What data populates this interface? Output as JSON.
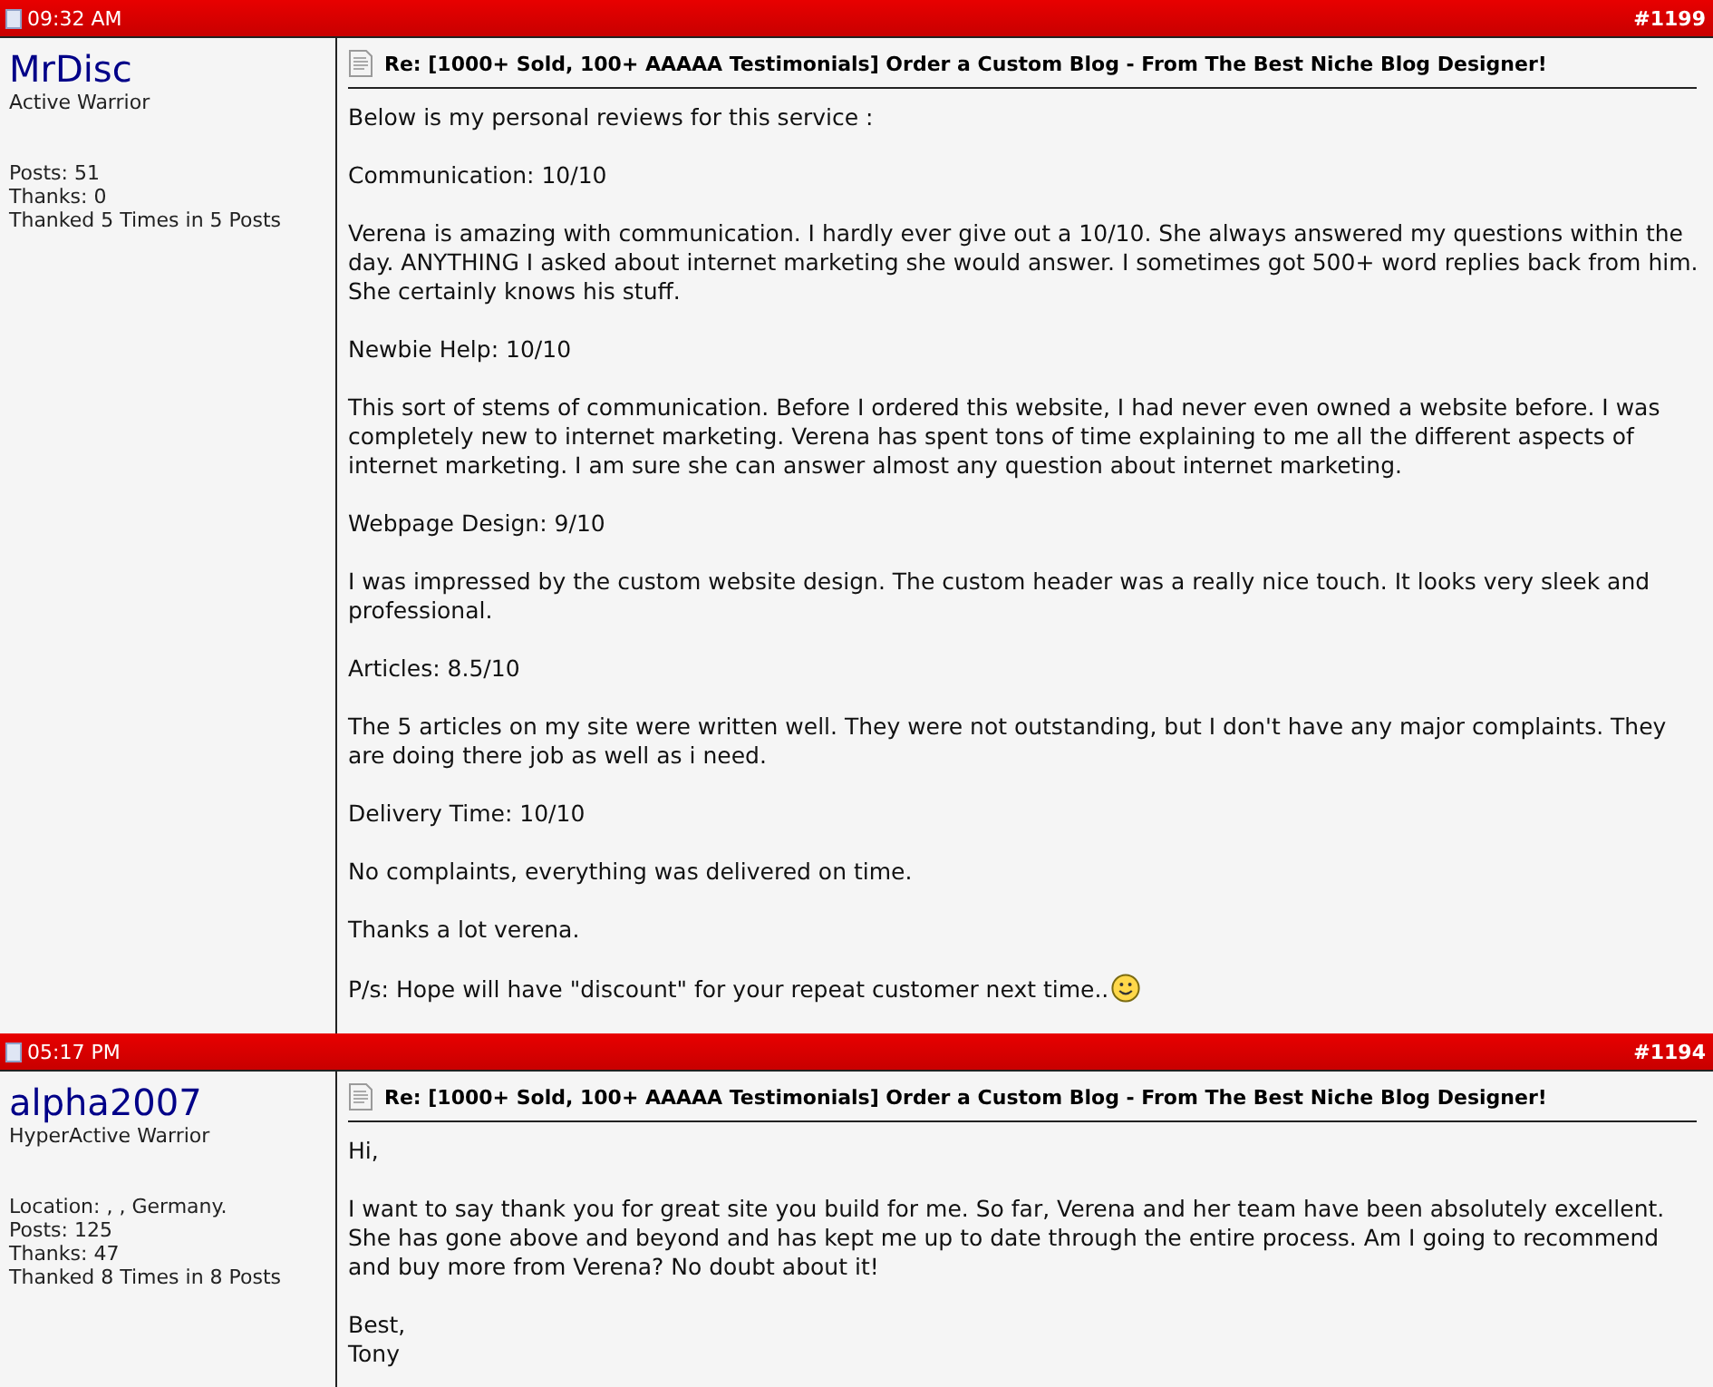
{
  "posts": [
    {
      "time": "09:32 AM",
      "number": "#1199",
      "user": {
        "name": "MrDisc",
        "rank": "Active Warrior",
        "stats": [
          "Posts: 51",
          "Thanks: 0",
          "Thanked 5 Times in 5 Posts"
        ]
      },
      "title": "Re: [1000+ Sold, 100+ AAAAA Testimonials] Order a Custom Blog - From The Best Niche Blog Designer!",
      "paragraphs": [
        {
          "text": "Below is my personal reviews for this service :",
          "smiley": false
        },
        {
          "text": "Communication: 10/10",
          "smiley": false
        },
        {
          "text": "Verena is amazing with communication. I hardly ever give out a 10/10. She always answered my questions within the day. ANYTHING I asked about internet marketing she would answer. I sometimes got 500+ word replies back from him. She certainly knows his stuff.",
          "smiley": false
        },
        {
          "text": "Newbie Help: 10/10",
          "smiley": false
        },
        {
          "text": "This sort of stems of communication. Before I ordered this website, I had never even owned a website before. I was completely new to internet marketing. Verena has spent tons of time explaining to me all the different aspects of internet marketing. I am sure she can answer almost any question about internet marketing.",
          "smiley": false
        },
        {
          "text": "Webpage Design: 9/10",
          "smiley": false
        },
        {
          "text": "I was impressed by the custom website design. The custom header was a really nice touch. It looks very sleek and professional.",
          "smiley": false
        },
        {
          "text": "Articles: 8.5/10",
          "smiley": false
        },
        {
          "text": "The 5 articles on my site were written well. They were not outstanding, but I don't have any major complaints. They are doing there job as well as i need.",
          "smiley": false
        },
        {
          "text": "Delivery Time: 10/10",
          "smiley": false
        },
        {
          "text": "No complaints, everything was delivered on time.",
          "smiley": false
        },
        {
          "text": "Thanks a lot verena.",
          "smiley": false
        },
        {
          "text": "P/s: Hope will have \"discount\" for your repeat customer next time..",
          "smiley": true
        }
      ]
    },
    {
      "time": "05:17 PM",
      "number": "#1194",
      "user": {
        "name": "alpha2007",
        "rank": "HyperActive Warrior",
        "stats": [
          "Location: , , Germany.",
          "Posts: 125",
          "Thanks: 47",
          "Thanked 8 Times in 8 Posts"
        ]
      },
      "title": "Re: [1000+ Sold, 100+ AAAAA Testimonials] Order a Custom Blog - From The Best Niche Blog Designer!",
      "paragraphs": [
        {
          "text": "Hi,",
          "smiley": false
        },
        {
          "text": "I want to say thank you for great site you build for me. So far, Verena and her team have been absolutely excellent. She has gone above and beyond and has kept me up to date through the entire process. Am I going to recommend and buy more from Verena? No doubt about it!",
          "smiley": false
        },
        {
          "text": "Best,\nTony",
          "smiley": false
        }
      ]
    }
  ]
}
